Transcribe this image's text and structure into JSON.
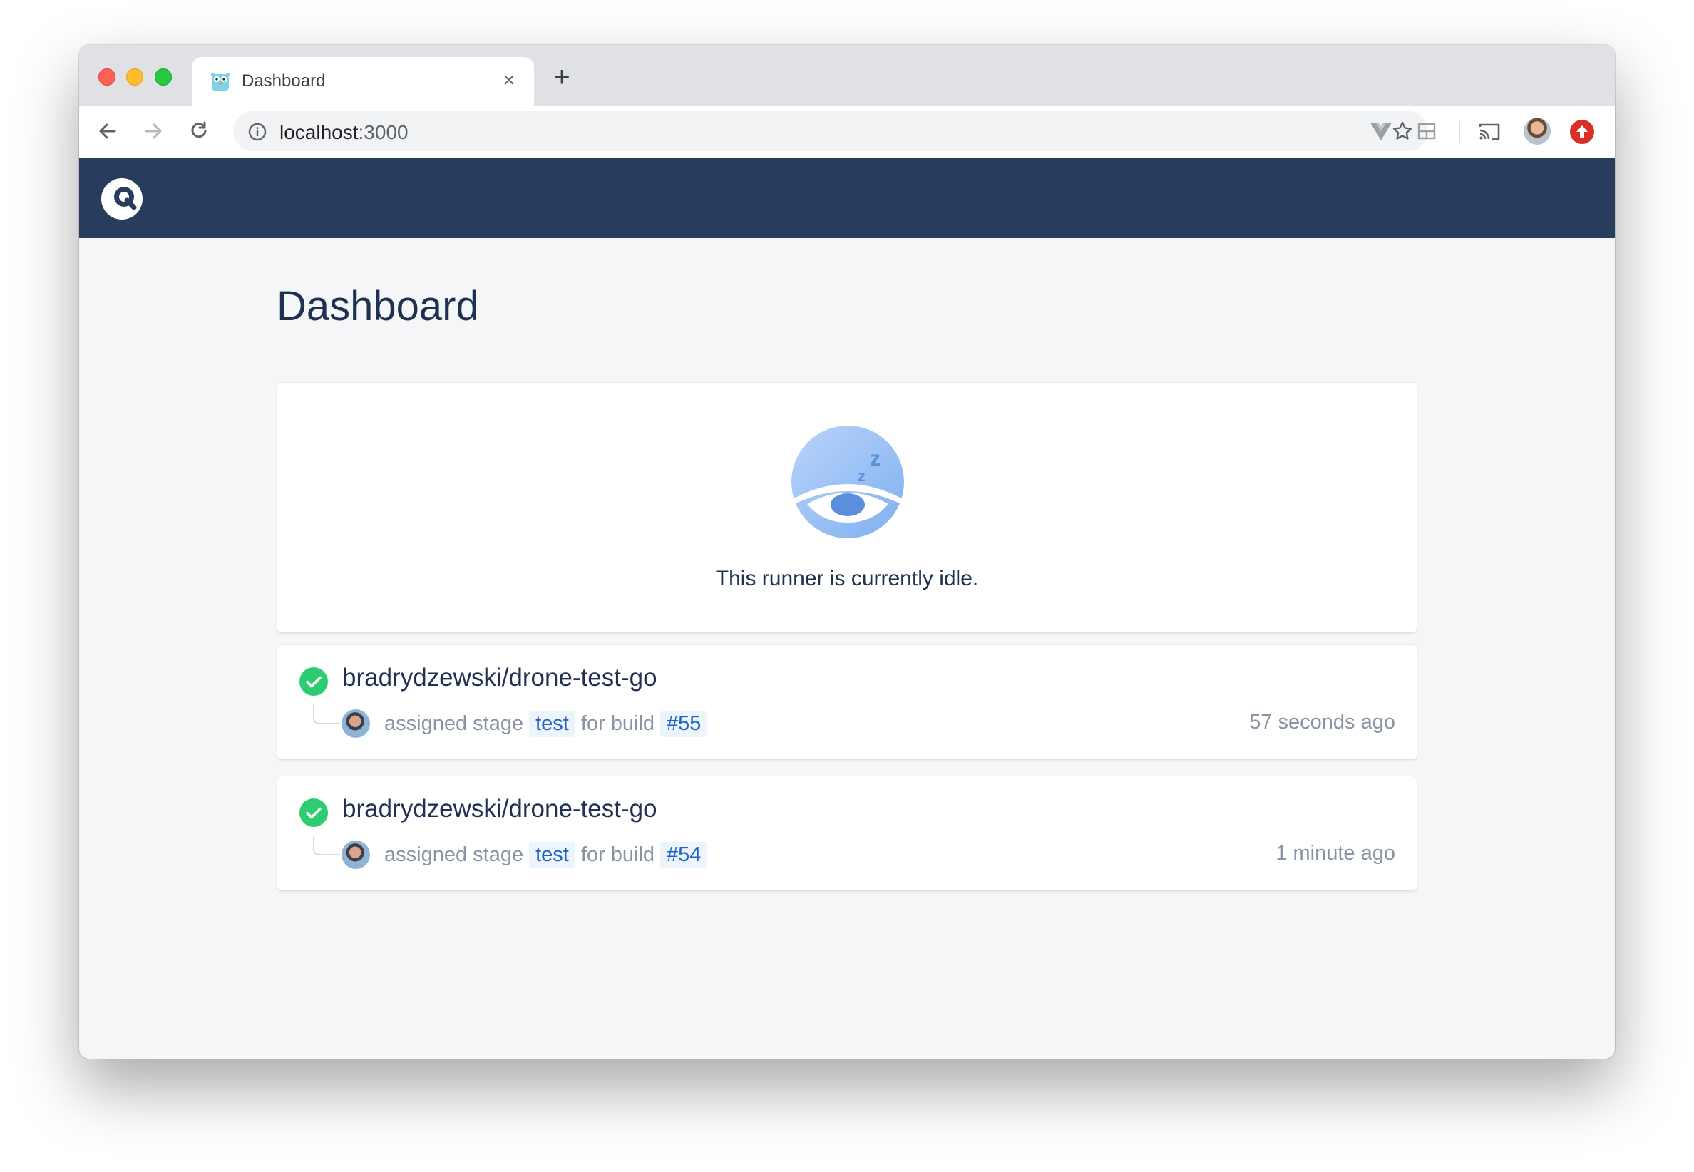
{
  "browser": {
    "tab": {
      "title": "Dashboard",
      "close_glyph": "×"
    },
    "new_tab_glyph": "+",
    "url": {
      "host": "localhost",
      "port": ":3000"
    }
  },
  "page": {
    "title": "Dashboard",
    "idle_message": "This runner is currently idle."
  },
  "builds": [
    {
      "repo": "bradrydzewski/drone-test-go",
      "status": "success",
      "action": "assigned stage",
      "stage": "test",
      "connector": "for build",
      "build": "#55",
      "time": "57 seconds ago"
    },
    {
      "repo": "bradrydzewski/drone-test-go",
      "status": "success",
      "action": "assigned stage",
      "stage": "test",
      "connector": "for build",
      "build": "#54",
      "time": "1 minute ago"
    }
  ],
  "colors": {
    "header": "#283c5e",
    "success": "#2ecc71",
    "accent": "#1f63c6"
  },
  "icons": {
    "back": "back-arrow-icon",
    "forward": "forward-arrow-icon",
    "reload": "reload-icon",
    "info": "info-icon",
    "star": "bookmark-star-icon",
    "logo": "drone-logo-icon",
    "status": "check-circle-icon"
  }
}
